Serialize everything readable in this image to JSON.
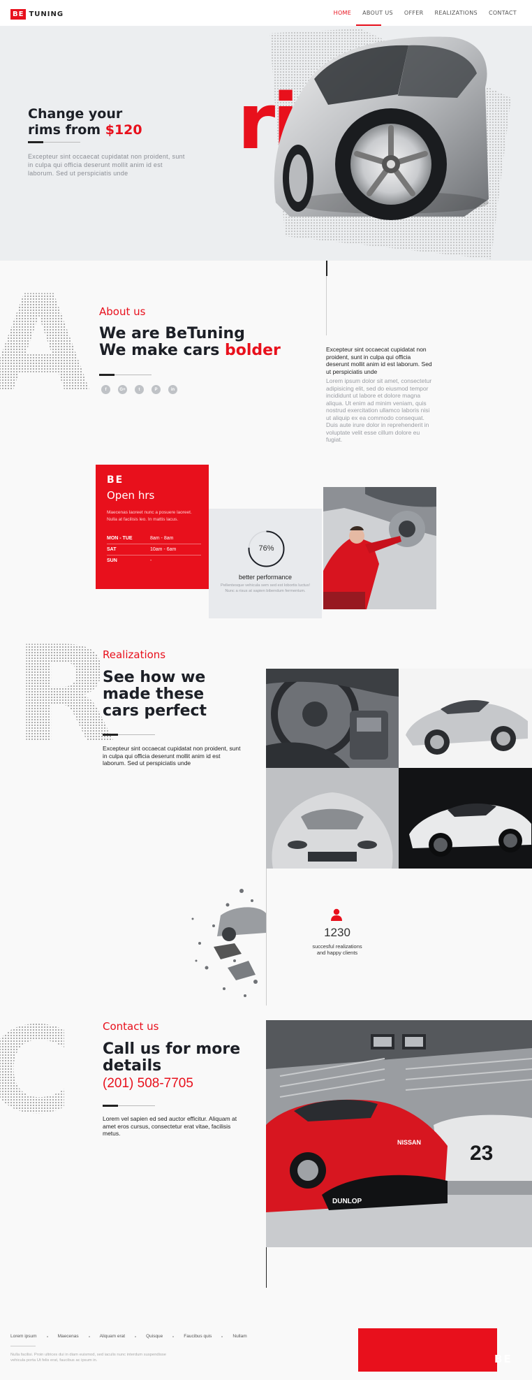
{
  "header": {
    "logo_box": "BE",
    "logo_text": "TUNING",
    "nav": [
      "HOME",
      "ABOUT US",
      "OFFER",
      "REALIZATIONS",
      "CONTACT"
    ]
  },
  "hero": {
    "title_line1": "Change your",
    "title_line2_prefix": "rims from ",
    "price": "$120",
    "desc": "Excepteur sint occaecat cupidatat non proident, sunt in culpa qui officia deserunt mollit anim id est laborum. Sed ut perspiciatis unde",
    "bg_letters": "rims"
  },
  "about": {
    "letter": "A",
    "label": "About us",
    "title_line1": "We are BeTuning",
    "title_line2_prefix": "We make cars ",
    "title_red": "bolder",
    "social": [
      "f",
      "G+",
      "t",
      "P",
      "in"
    ],
    "lead": "Excepteur sint occaecat cupidatat non proident, sunt in culpa qui officia deserunt mollit anim id est laborum. Sed ut perspiciatis unde",
    "body": "Lorem ipsum dolor sit amet, consectetur adipisicing elit, sed do eiusmod tempor incididunt ut labore et dolore magna aliqua. Ut enim ad minim veniam, quis nostrud exercitation ullamco laboris nisi ut aliquip ex ea commodo consequat. Duis aute irure dolor in reprehenderit in voluptate velit esse cillum dolore eu fugiat."
  },
  "hours": {
    "brand": "BE",
    "title": "Open hrs",
    "text": "Maecenas laoreet nunc a posuere laoreet. Nulla at facilisis leo. In mattis lacus.",
    "rows": [
      {
        "day": "MON - TUE",
        "time": "8am - 8am"
      },
      {
        "day": "SAT",
        "time": "10am - 6am"
      },
      {
        "day": "SUN",
        "time": "-"
      }
    ]
  },
  "performance": {
    "value": "76%",
    "fraction": 0.76,
    "label": "better performance",
    "text": "Pellentesque vehicula sem sed est lobortis luctus! Nunc a risus at sapien bibendum fermentum."
  },
  "realizations": {
    "letter": "R",
    "label": "Realizations",
    "title_line1": "See how we",
    "title_line2": "made these",
    "title_line3": "cars perfect",
    "text": "Excepteur sint occaecat cupidatat non proident, sunt in culpa qui officia deserunt mollit anim id est laborum. Sed ut perspiciatis unde"
  },
  "stats": {
    "icon": "user-icon",
    "value": "1230",
    "label_line1": "succesful realizations",
    "label_line2": "and happy clients"
  },
  "contact": {
    "letter": "C",
    "label": "Contact us",
    "title_line1": "Call us for more",
    "title_line2": "details",
    "phone": "(201) 508-7705",
    "text": "Lorem vel sapien ed sed auctor efficitur. Aliquam at amet eros cursus, consectetur erat vitae, facilisis metus.",
    "photo_text": {
      "plate": "23",
      "sponsor": "DUNLOP",
      "brand": "NISSAN"
    }
  },
  "footer": {
    "links": [
      "Lorem ipsum",
      "Maecenas",
      "Aliquam erat",
      "Quisque",
      "Faucibus quis",
      "Nullam"
    ],
    "text": "Nulla facilisi. Proin ultrices dui in diam euismod, sed iaculis nunc interdum suspendisse vehicula porta Ut felis erat, faucibus ac ipsum in.",
    "brand": "BE"
  },
  "colors": {
    "accent": "#e8101c",
    "dark": "#1c1f26",
    "hero_bg": "#eceef0"
  }
}
